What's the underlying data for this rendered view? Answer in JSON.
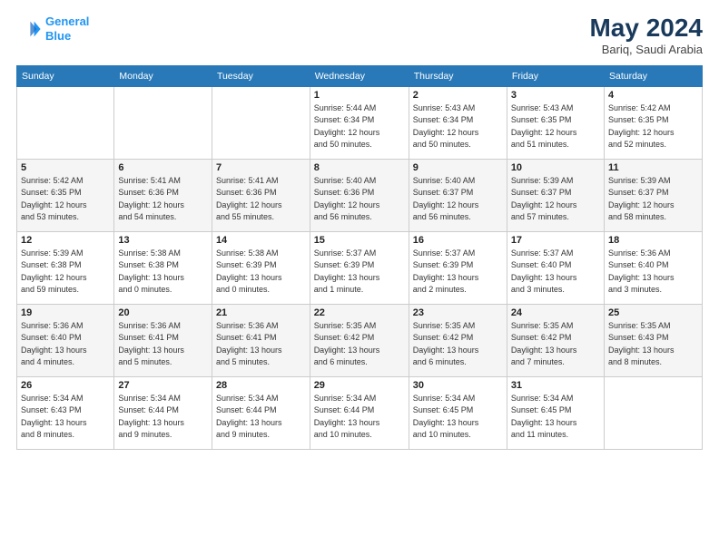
{
  "header": {
    "logo_line1": "General",
    "logo_line2": "Blue",
    "month_year": "May 2024",
    "location": "Bariq, Saudi Arabia"
  },
  "weekdays": [
    "Sunday",
    "Monday",
    "Tuesday",
    "Wednesday",
    "Thursday",
    "Friday",
    "Saturday"
  ],
  "weeks": [
    [
      {
        "day": "",
        "info": ""
      },
      {
        "day": "",
        "info": ""
      },
      {
        "day": "",
        "info": ""
      },
      {
        "day": "1",
        "info": "Sunrise: 5:44 AM\nSunset: 6:34 PM\nDaylight: 12 hours\nand 50 minutes."
      },
      {
        "day": "2",
        "info": "Sunrise: 5:43 AM\nSunset: 6:34 PM\nDaylight: 12 hours\nand 50 minutes."
      },
      {
        "day": "3",
        "info": "Sunrise: 5:43 AM\nSunset: 6:35 PM\nDaylight: 12 hours\nand 51 minutes."
      },
      {
        "day": "4",
        "info": "Sunrise: 5:42 AM\nSunset: 6:35 PM\nDaylight: 12 hours\nand 52 minutes."
      }
    ],
    [
      {
        "day": "5",
        "info": "Sunrise: 5:42 AM\nSunset: 6:35 PM\nDaylight: 12 hours\nand 53 minutes."
      },
      {
        "day": "6",
        "info": "Sunrise: 5:41 AM\nSunset: 6:36 PM\nDaylight: 12 hours\nand 54 minutes."
      },
      {
        "day": "7",
        "info": "Sunrise: 5:41 AM\nSunset: 6:36 PM\nDaylight: 12 hours\nand 55 minutes."
      },
      {
        "day": "8",
        "info": "Sunrise: 5:40 AM\nSunset: 6:36 PM\nDaylight: 12 hours\nand 56 minutes."
      },
      {
        "day": "9",
        "info": "Sunrise: 5:40 AM\nSunset: 6:37 PM\nDaylight: 12 hours\nand 56 minutes."
      },
      {
        "day": "10",
        "info": "Sunrise: 5:39 AM\nSunset: 6:37 PM\nDaylight: 12 hours\nand 57 minutes."
      },
      {
        "day": "11",
        "info": "Sunrise: 5:39 AM\nSunset: 6:37 PM\nDaylight: 12 hours\nand 58 minutes."
      }
    ],
    [
      {
        "day": "12",
        "info": "Sunrise: 5:39 AM\nSunset: 6:38 PM\nDaylight: 12 hours\nand 59 minutes."
      },
      {
        "day": "13",
        "info": "Sunrise: 5:38 AM\nSunset: 6:38 PM\nDaylight: 13 hours\nand 0 minutes."
      },
      {
        "day": "14",
        "info": "Sunrise: 5:38 AM\nSunset: 6:39 PM\nDaylight: 13 hours\nand 0 minutes."
      },
      {
        "day": "15",
        "info": "Sunrise: 5:37 AM\nSunset: 6:39 PM\nDaylight: 13 hours\nand 1 minute."
      },
      {
        "day": "16",
        "info": "Sunrise: 5:37 AM\nSunset: 6:39 PM\nDaylight: 13 hours\nand 2 minutes."
      },
      {
        "day": "17",
        "info": "Sunrise: 5:37 AM\nSunset: 6:40 PM\nDaylight: 13 hours\nand 3 minutes."
      },
      {
        "day": "18",
        "info": "Sunrise: 5:36 AM\nSunset: 6:40 PM\nDaylight: 13 hours\nand 3 minutes."
      }
    ],
    [
      {
        "day": "19",
        "info": "Sunrise: 5:36 AM\nSunset: 6:40 PM\nDaylight: 13 hours\nand 4 minutes."
      },
      {
        "day": "20",
        "info": "Sunrise: 5:36 AM\nSunset: 6:41 PM\nDaylight: 13 hours\nand 5 minutes."
      },
      {
        "day": "21",
        "info": "Sunrise: 5:36 AM\nSunset: 6:41 PM\nDaylight: 13 hours\nand 5 minutes."
      },
      {
        "day": "22",
        "info": "Sunrise: 5:35 AM\nSunset: 6:42 PM\nDaylight: 13 hours\nand 6 minutes."
      },
      {
        "day": "23",
        "info": "Sunrise: 5:35 AM\nSunset: 6:42 PM\nDaylight: 13 hours\nand 6 minutes."
      },
      {
        "day": "24",
        "info": "Sunrise: 5:35 AM\nSunset: 6:42 PM\nDaylight: 13 hours\nand 7 minutes."
      },
      {
        "day": "25",
        "info": "Sunrise: 5:35 AM\nSunset: 6:43 PM\nDaylight: 13 hours\nand 8 minutes."
      }
    ],
    [
      {
        "day": "26",
        "info": "Sunrise: 5:34 AM\nSunset: 6:43 PM\nDaylight: 13 hours\nand 8 minutes."
      },
      {
        "day": "27",
        "info": "Sunrise: 5:34 AM\nSunset: 6:44 PM\nDaylight: 13 hours\nand 9 minutes."
      },
      {
        "day": "28",
        "info": "Sunrise: 5:34 AM\nSunset: 6:44 PM\nDaylight: 13 hours\nand 9 minutes."
      },
      {
        "day": "29",
        "info": "Sunrise: 5:34 AM\nSunset: 6:44 PM\nDaylight: 13 hours\nand 10 minutes."
      },
      {
        "day": "30",
        "info": "Sunrise: 5:34 AM\nSunset: 6:45 PM\nDaylight: 13 hours\nand 10 minutes."
      },
      {
        "day": "31",
        "info": "Sunrise: 5:34 AM\nSunset: 6:45 PM\nDaylight: 13 hours\nand 11 minutes."
      },
      {
        "day": "",
        "info": ""
      }
    ]
  ]
}
